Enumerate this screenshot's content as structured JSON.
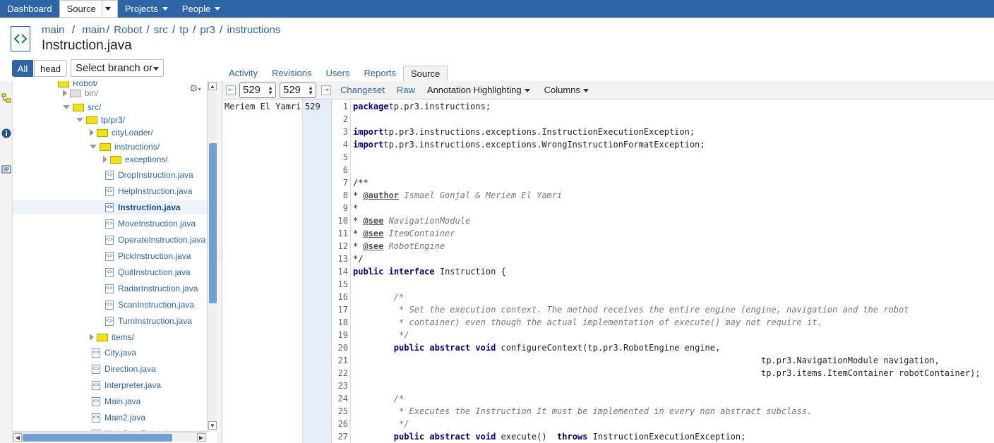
{
  "topnav": {
    "items": [
      {
        "label": "Dashboard",
        "selected": false
      },
      {
        "label": "Source",
        "selected": true
      },
      {
        "label": "Projects",
        "selected": false
      },
      {
        "label": "People",
        "selected": false
      }
    ]
  },
  "breadcrumb": [
    "main",
    "main",
    "Robot",
    "src",
    "tp",
    "pr3",
    "instructions"
  ],
  "page_title": "Instruction.java",
  "filter": {
    "all_label": "All",
    "head_label": "head",
    "branch_select": "Select branch or"
  },
  "tabs": [
    {
      "label": "Activity",
      "active": false
    },
    {
      "label": "Revisions",
      "active": false
    },
    {
      "label": "Users",
      "active": false
    },
    {
      "label": "Reports",
      "active": false
    },
    {
      "label": "Source",
      "active": true
    }
  ],
  "toolbar": {
    "from_rev": "529",
    "to_rev": "529",
    "changeset_label": "Changeset",
    "raw_label": "Raw",
    "annotation_label": "Annotation Highlighting",
    "columns_label": "Columns"
  },
  "tree": [
    {
      "label": "Robot/",
      "type": "folder",
      "depth": 3,
      "expand": "none"
    },
    {
      "label": "bin/",
      "type": "folder-grey",
      "depth": 4,
      "expand": "collapsed"
    },
    {
      "label": "src/",
      "type": "folder",
      "depth": 4,
      "expand": "expanded"
    },
    {
      "label": "tp/pr3/",
      "type": "folder",
      "depth": 5,
      "expand": "expanded"
    },
    {
      "label": "cityLoader/",
      "type": "folder",
      "depth": 6,
      "expand": "collapsed"
    },
    {
      "label": "instructions/",
      "type": "folder",
      "depth": 6,
      "expand": "expanded"
    },
    {
      "label": "exceptions/",
      "type": "folder",
      "depth": 7,
      "expand": "collapsed"
    },
    {
      "label": "DropInstruction.java",
      "type": "file",
      "depth": 7
    },
    {
      "label": "HelpInstruction.java",
      "type": "file",
      "depth": 7
    },
    {
      "label": "Instruction.java",
      "type": "file",
      "depth": 7,
      "selected": true
    },
    {
      "label": "MoveInstruction.java",
      "type": "file",
      "depth": 7
    },
    {
      "label": "OperateInstruction.java",
      "type": "file",
      "depth": 7
    },
    {
      "label": "PickInstruction.java",
      "type": "file",
      "depth": 7
    },
    {
      "label": "QuitInstruction.java",
      "type": "file",
      "depth": 7
    },
    {
      "label": "RadarInstruction.java",
      "type": "file",
      "depth": 7
    },
    {
      "label": "ScanInstruction.java",
      "type": "file",
      "depth": 7
    },
    {
      "label": "TurnInstruction.java",
      "type": "file",
      "depth": 7
    },
    {
      "label": "items/",
      "type": "folder",
      "depth": 6,
      "expand": "collapsed"
    },
    {
      "label": "City.java",
      "type": "file",
      "depth": 6
    },
    {
      "label": "Direction.java",
      "type": "file",
      "depth": 6
    },
    {
      "label": "Interpreter.java",
      "type": "file",
      "depth": 6
    },
    {
      "label": "Main.java",
      "type": "file",
      "depth": 6
    },
    {
      "label": "Main2.java",
      "type": "file",
      "depth": 6
    },
    {
      "label": "MainDataRobot.java",
      "type": "file",
      "depth": 6
    }
  ],
  "annotation": {
    "author": "Meriem El Yamri",
    "revision": "529"
  },
  "code_lines": [
    [
      [
        "kw",
        "package"
      ],
      [
        "",
        "tp.pr3.instructions;"
      ]
    ],
    [],
    [
      [
        "kw",
        "import"
      ],
      [
        "",
        "tp.pr3.instructions.exceptions.InstructionExecutionException;"
      ]
    ],
    [
      [
        "kw",
        "import"
      ],
      [
        "",
        "tp.pr3.instructions.exceptions.WrongInstructionFormatException;"
      ]
    ],
    [],
    [],
    [
      [
        "",
        "/**"
      ]
    ],
    [
      [
        "",
        "* "
      ],
      [
        "ctag",
        "@author"
      ],
      [
        "cm",
        " Ismael Gonjal & Meriem El Yamri"
      ]
    ],
    [
      [
        "",
        "*"
      ]
    ],
    [
      [
        "",
        "* "
      ],
      [
        "ctag",
        "@see"
      ],
      [
        "cm",
        " NavigationModule"
      ]
    ],
    [
      [
        "",
        "* "
      ],
      [
        "ctag",
        "@see"
      ],
      [
        "cm",
        " ItemContainer"
      ]
    ],
    [
      [
        "",
        "* "
      ],
      [
        "ctag",
        "@see"
      ],
      [
        "cm",
        " RobotEngine"
      ]
    ],
    [
      [
        "",
        "*/"
      ]
    ],
    [
      [
        "kw",
        "public"
      ],
      [
        "",
        " "
      ],
      [
        "kw",
        "interface"
      ],
      [
        "",
        " Instruction {"
      ]
    ],
    [],
    [
      [
        "cm",
        "        /*"
      ]
    ],
    [
      [
        "cm",
        "         * Set the execution context. The method receives the entire engine (engine, navigation and the robot"
      ]
    ],
    [
      [
        "cm",
        "         * container) even though the actual implementation of execute() may not require it."
      ]
    ],
    [
      [
        "cm",
        "         */"
      ]
    ],
    [
      [
        "",
        "        "
      ],
      [
        "kw",
        "public"
      ],
      [
        "",
        " "
      ],
      [
        "kw",
        "abstract"
      ],
      [
        "",
        " "
      ],
      [
        "kw",
        "void"
      ],
      [
        "",
        " configureContext(tp.pr3.RobotEngine engine,"
      ]
    ],
    [
      [
        "",
        "                                                                                tp.pr3.NavigationModule navigation,"
      ]
    ],
    [
      [
        "",
        "                                                                                tp.pr3.items.ItemContainer robotContainer);"
      ]
    ],
    [],
    [
      [
        "cm",
        "        /*"
      ]
    ],
    [
      [
        "cm",
        "         * Executes the Instruction It must be implemented in every non abstract subclass."
      ]
    ],
    [
      [
        "cm",
        "         */"
      ]
    ],
    [
      [
        "",
        "        "
      ],
      [
        "kw",
        "public"
      ],
      [
        "",
        " "
      ],
      [
        "kw",
        "abstract"
      ],
      [
        "",
        " "
      ],
      [
        "kw",
        "void"
      ],
      [
        "",
        " execute()  "
      ],
      [
        "kw",
        "throws"
      ],
      [
        "",
        " InstructionExecutionException;"
      ]
    ]
  ],
  "colors": {
    "nav": "#2e65a6",
    "rev_column": "#e4eff7",
    "folder": "#f2e210",
    "keyword": "#000080"
  }
}
